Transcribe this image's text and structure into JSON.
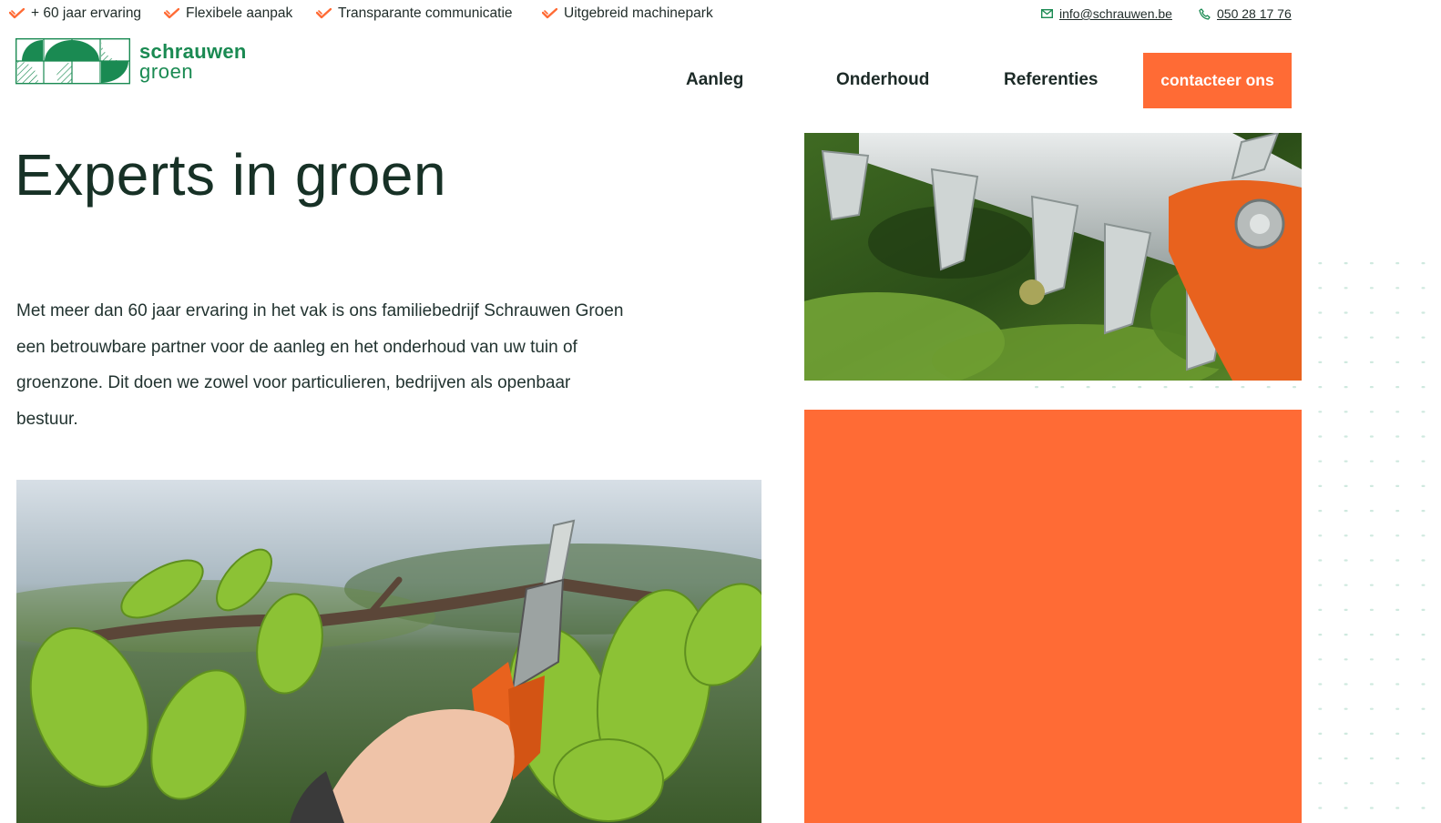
{
  "topbar": {
    "usps": [
      "+ 60 jaar ervaring",
      "Flexibele aanpak",
      "Transparante communicatie",
      "Uitgebreid machinepark"
    ],
    "email": "info@schrauwen.be",
    "phone": "050 28 17 76"
  },
  "logo": {
    "line1": "schrauwen",
    "line2": "groen"
  },
  "nav": {
    "items": [
      "Aanleg",
      "Onderhoud",
      "Referenties"
    ],
    "cta": "contacteer ons"
  },
  "hero": {
    "title": "Experts in groen",
    "text": "Met meer dan 60 jaar ervaring in het vak is ons familiebedrijf Schrauwen Groen een betrouwbare partner voor de aanleg en het onderhoud van uw tuin of groenzone. Dit doen we zowel voor particulieren, bedrijven als openbaar bestuur."
  },
  "images": {
    "hedge": "hedge-trimmer-photo",
    "pruner": "pruning-shears-photo"
  },
  "colors": {
    "accent": "#ff6b35",
    "brand_green": "#1a8a52",
    "text_dark": "#173126"
  }
}
